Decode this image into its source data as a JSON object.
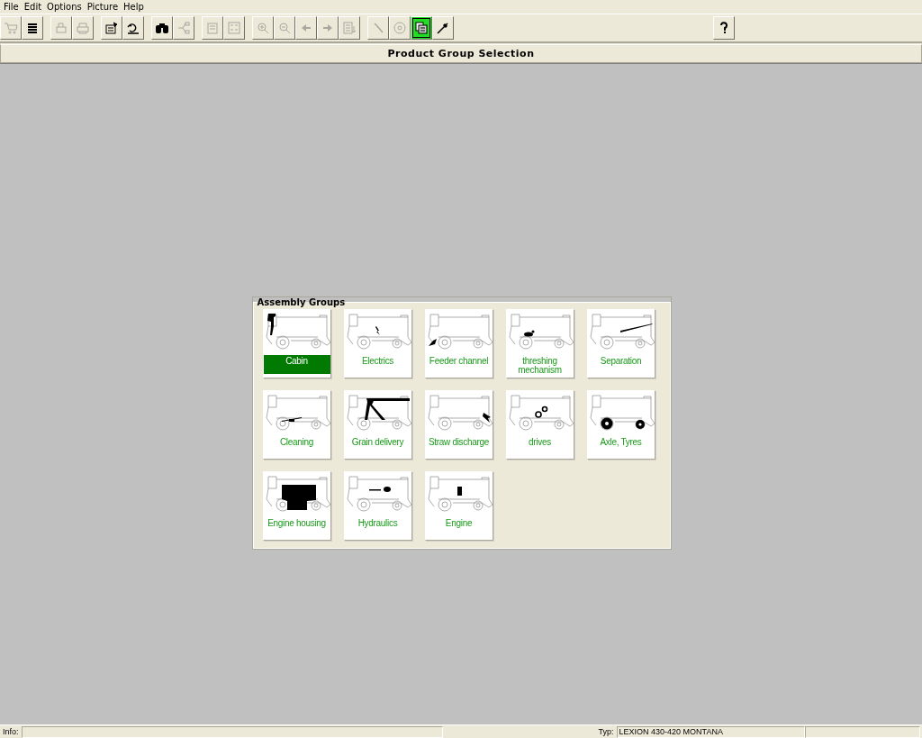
{
  "menu": [
    "File",
    "Edit",
    "Options",
    "Picture",
    "Help"
  ],
  "toolbar": [
    [
      {
        "disabled": true,
        "selected": false
      },
      {
        "disabled": false,
        "selected": false
      }
    ],
    [
      {
        "disabled": true,
        "selected": false
      },
      {
        "disabled": true,
        "selected": false
      }
    ],
    [
      {
        "disabled": false,
        "selected": false
      },
      {
        "disabled": false,
        "selected": false
      }
    ],
    [
      {
        "disabled": false,
        "selected": false
      },
      {
        "disabled": true,
        "selected": false
      }
    ],
    [
      {
        "disabled": true,
        "selected": false
      },
      {
        "disabled": true,
        "selected": false
      }
    ],
    [
      {
        "disabled": true,
        "selected": false
      },
      {
        "disabled": true,
        "selected": false
      },
      {
        "disabled": true,
        "selected": false
      },
      {
        "disabled": true,
        "selected": false
      },
      {
        "disabled": true,
        "selected": false
      }
    ],
    [
      {
        "disabled": true,
        "selected": false
      },
      {
        "disabled": true,
        "selected": false
      },
      {
        "disabled": false,
        "selected": true
      },
      {
        "disabled": false,
        "selected": false
      }
    ]
  ],
  "help_button": {
    "disabled": false
  },
  "title": "Product Group Selection",
  "assembly_groups": {
    "title": "Assembly Groups",
    "items": [
      {
        "label": "Cabin",
        "selected": true
      },
      {
        "label": "Electrics",
        "selected": false
      },
      {
        "label": "Feeder channel",
        "selected": false
      },
      {
        "label": "threshing mechanism",
        "selected": false
      },
      {
        "label": "Separation",
        "selected": false
      },
      {
        "label": "Cleaning",
        "selected": false
      },
      {
        "label": "Grain delivery",
        "selected": false
      },
      {
        "label": "Straw discharge",
        "selected": false
      },
      {
        "label": "drives",
        "selected": false
      },
      {
        "label": "Axle, Tyres",
        "selected": false
      },
      {
        "label": "Engine housing",
        "selected": false
      },
      {
        "label": "Hydraulics",
        "selected": false
      },
      {
        "label": "Engine",
        "selected": false
      }
    ]
  },
  "status_bar": {
    "info_label": "Info:",
    "type_label": "Typ:",
    "type_value": "LEXION 430-420 MONTANA"
  }
}
